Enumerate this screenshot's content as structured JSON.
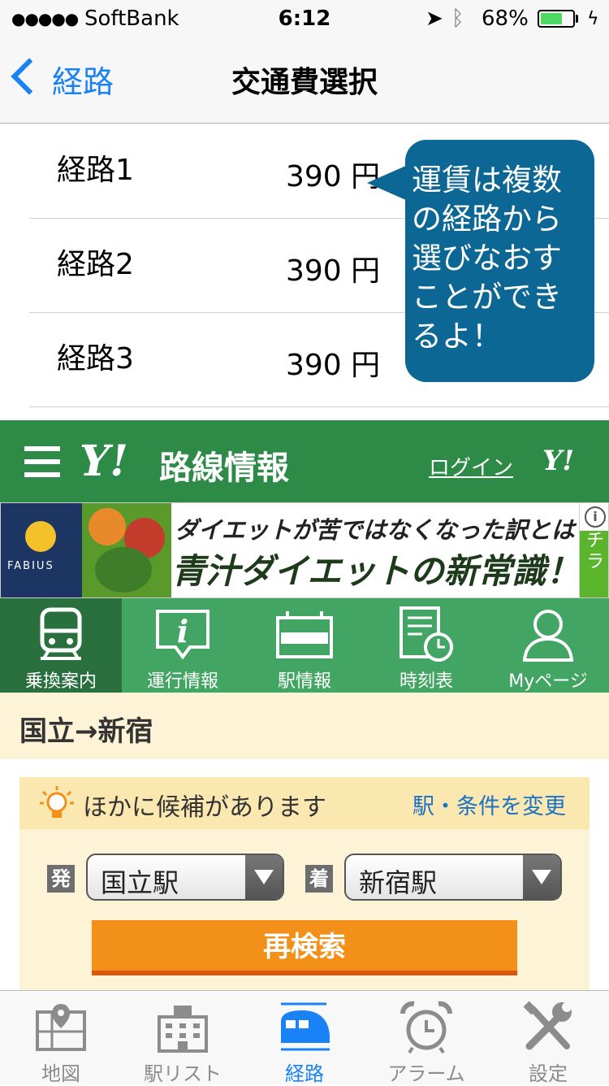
{
  "status_bar": {
    "signal": "●●●●●",
    "carrier": "SoftBank",
    "time": "6:12",
    "battery_percent": "68%",
    "battery_level": 0.68
  },
  "nav": {
    "back_label": "経路",
    "title": "交通費選択"
  },
  "routes": [
    {
      "name": "経路1",
      "price": "390 円"
    },
    {
      "name": "経路2",
      "price": "390 円"
    },
    {
      "name": "経路3",
      "price": "390 円"
    }
  ],
  "tooltip": {
    "text": " 運賃は複数の経路から選びなおすことができるよ！"
  },
  "yahoo_header": {
    "logo": "Y!",
    "title": "路線情報",
    "login": "ログイン",
    "logo_small": "Y!"
  },
  "ad": {
    "brand": "FABIUS",
    "line1": "ダイエットが苦ではなくなった訳とは",
    "line2": "青汁ダイエットの新常識！",
    "side_label": "チラ"
  },
  "tabs": [
    {
      "label": "乗換案内",
      "icon": "train-icon"
    },
    {
      "label": "運行情報",
      "icon": "info-icon"
    },
    {
      "label": "駅情報",
      "icon": "station-sign-icon"
    },
    {
      "label": "時刻表",
      "icon": "timetable-icon"
    },
    {
      "label": "Myページ",
      "icon": "user-icon"
    }
  ],
  "route_title": "国立→新宿",
  "candidate": {
    "text": "ほかに候補があります",
    "link": "駅・条件を変更",
    "from_tag": "発",
    "from_value": "国立駅",
    "to_tag": "着",
    "to_value": "新宿駅",
    "search_button": "再検索"
  },
  "tabbar": [
    {
      "label": "地図",
      "icon": "map-icon"
    },
    {
      "label": "駅リスト",
      "icon": "building-icon"
    },
    {
      "label": "経路",
      "icon": "train-icon"
    },
    {
      "label": "アラーム",
      "icon": "alarm-clock-icon"
    },
    {
      "label": "設定",
      "icon": "tools-icon"
    }
  ],
  "colors": {
    "ios_blue": "#1a82f7",
    "yahoo_green": "#2e8b47",
    "tab_green": "#43a564",
    "bubble_blue": "#0d6794",
    "orange": "#f39019"
  }
}
